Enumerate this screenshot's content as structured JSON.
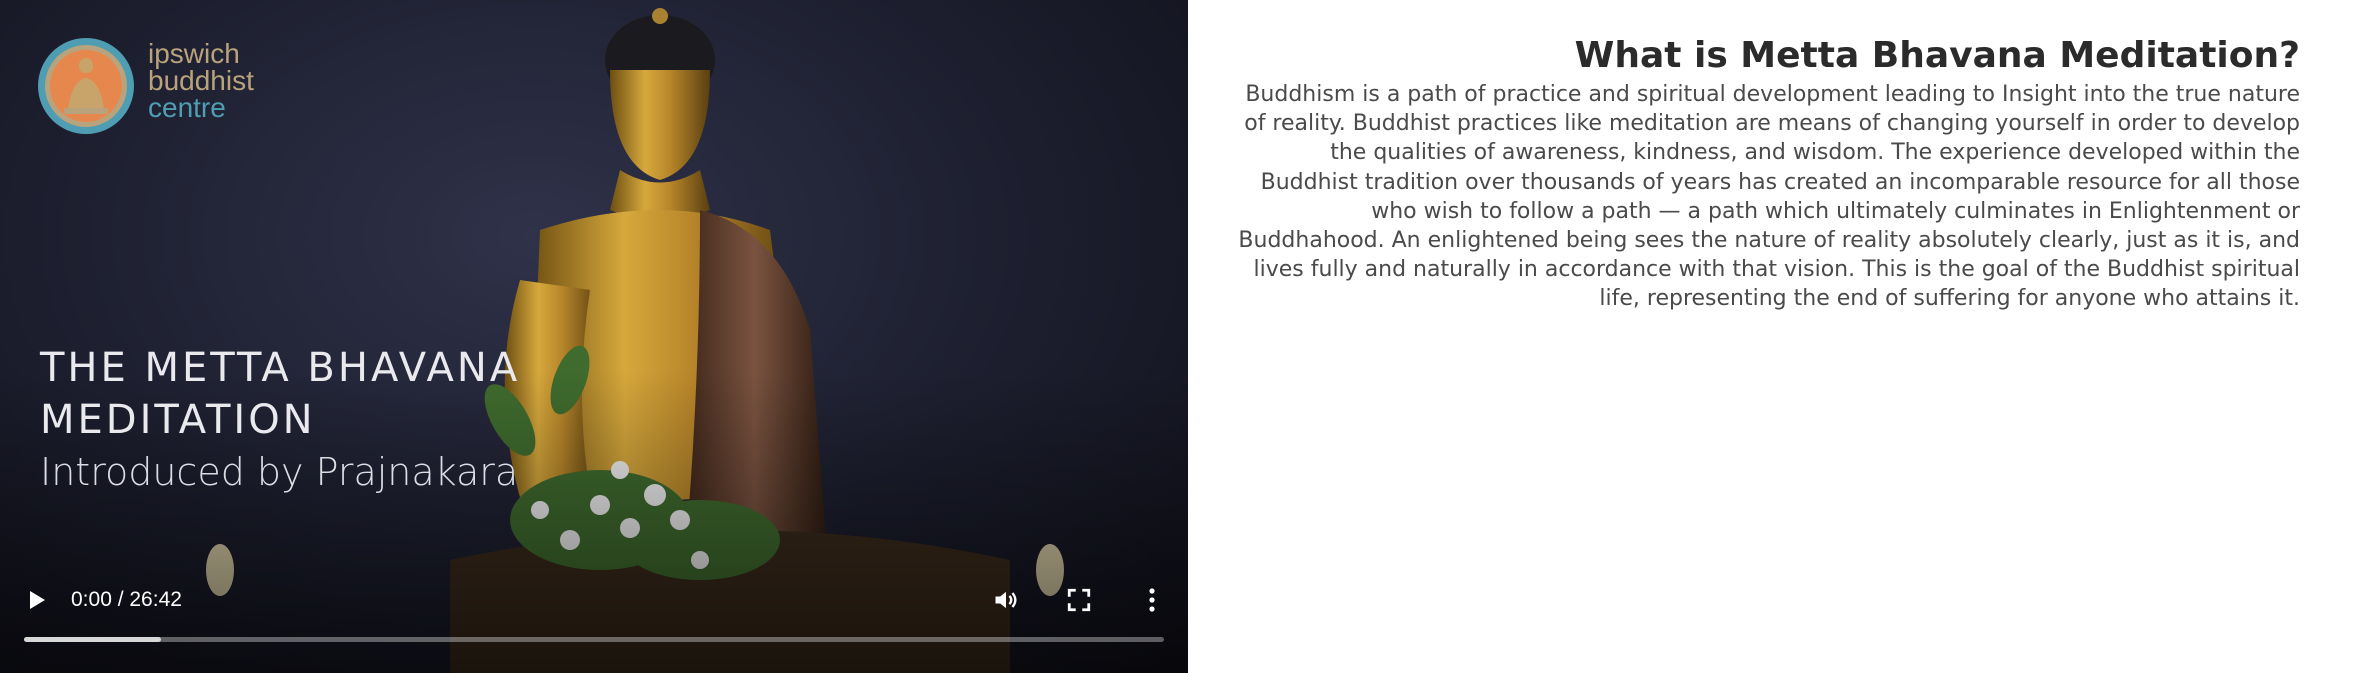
{
  "video": {
    "logo": {
      "line1": "ipswich",
      "line2": "buddhist",
      "line3": "centre"
    },
    "poster_title_line1": "THE METTA BHAVANA",
    "poster_title_line2": "MEDITATION",
    "poster_subtitle": "Introduced by Prajnakara",
    "controls": {
      "play_icon": "play-icon",
      "time": "0:00 / 26:42",
      "volume_icon": "volume-icon",
      "fullscreen_icon": "fullscreen-icon",
      "more_icon": "more-vert-icon",
      "buffered_fraction": 0.12
    }
  },
  "article": {
    "heading": "What is Metta Bhavana Meditation?",
    "body": "Buddhism is a path of practice and spiritual development leading to Insight into the true nature of reality. Buddhist practices like meditation are means of changing yourself in order to develop the qualities of awareness, kindness, and wisdom. The experience developed within the Buddhist tradition over thousands of years has created an incomparable resource for all those who wish to follow a path — a path which ultimately culminates in Enlightenment or Buddhahood. An enlightened being sees the nature of reality absolutely clearly, just as it is, and lives fully and naturally in accordance with that vision. This is the goal of the Buddhist spiritual life, representing the end of suffering for anyone who attains it."
  },
  "colors": {
    "heading": "#2b2b2b",
    "body": "#4a4a4a",
    "logo_tan": "#b9a37c",
    "logo_teal": "#4f9db2"
  }
}
